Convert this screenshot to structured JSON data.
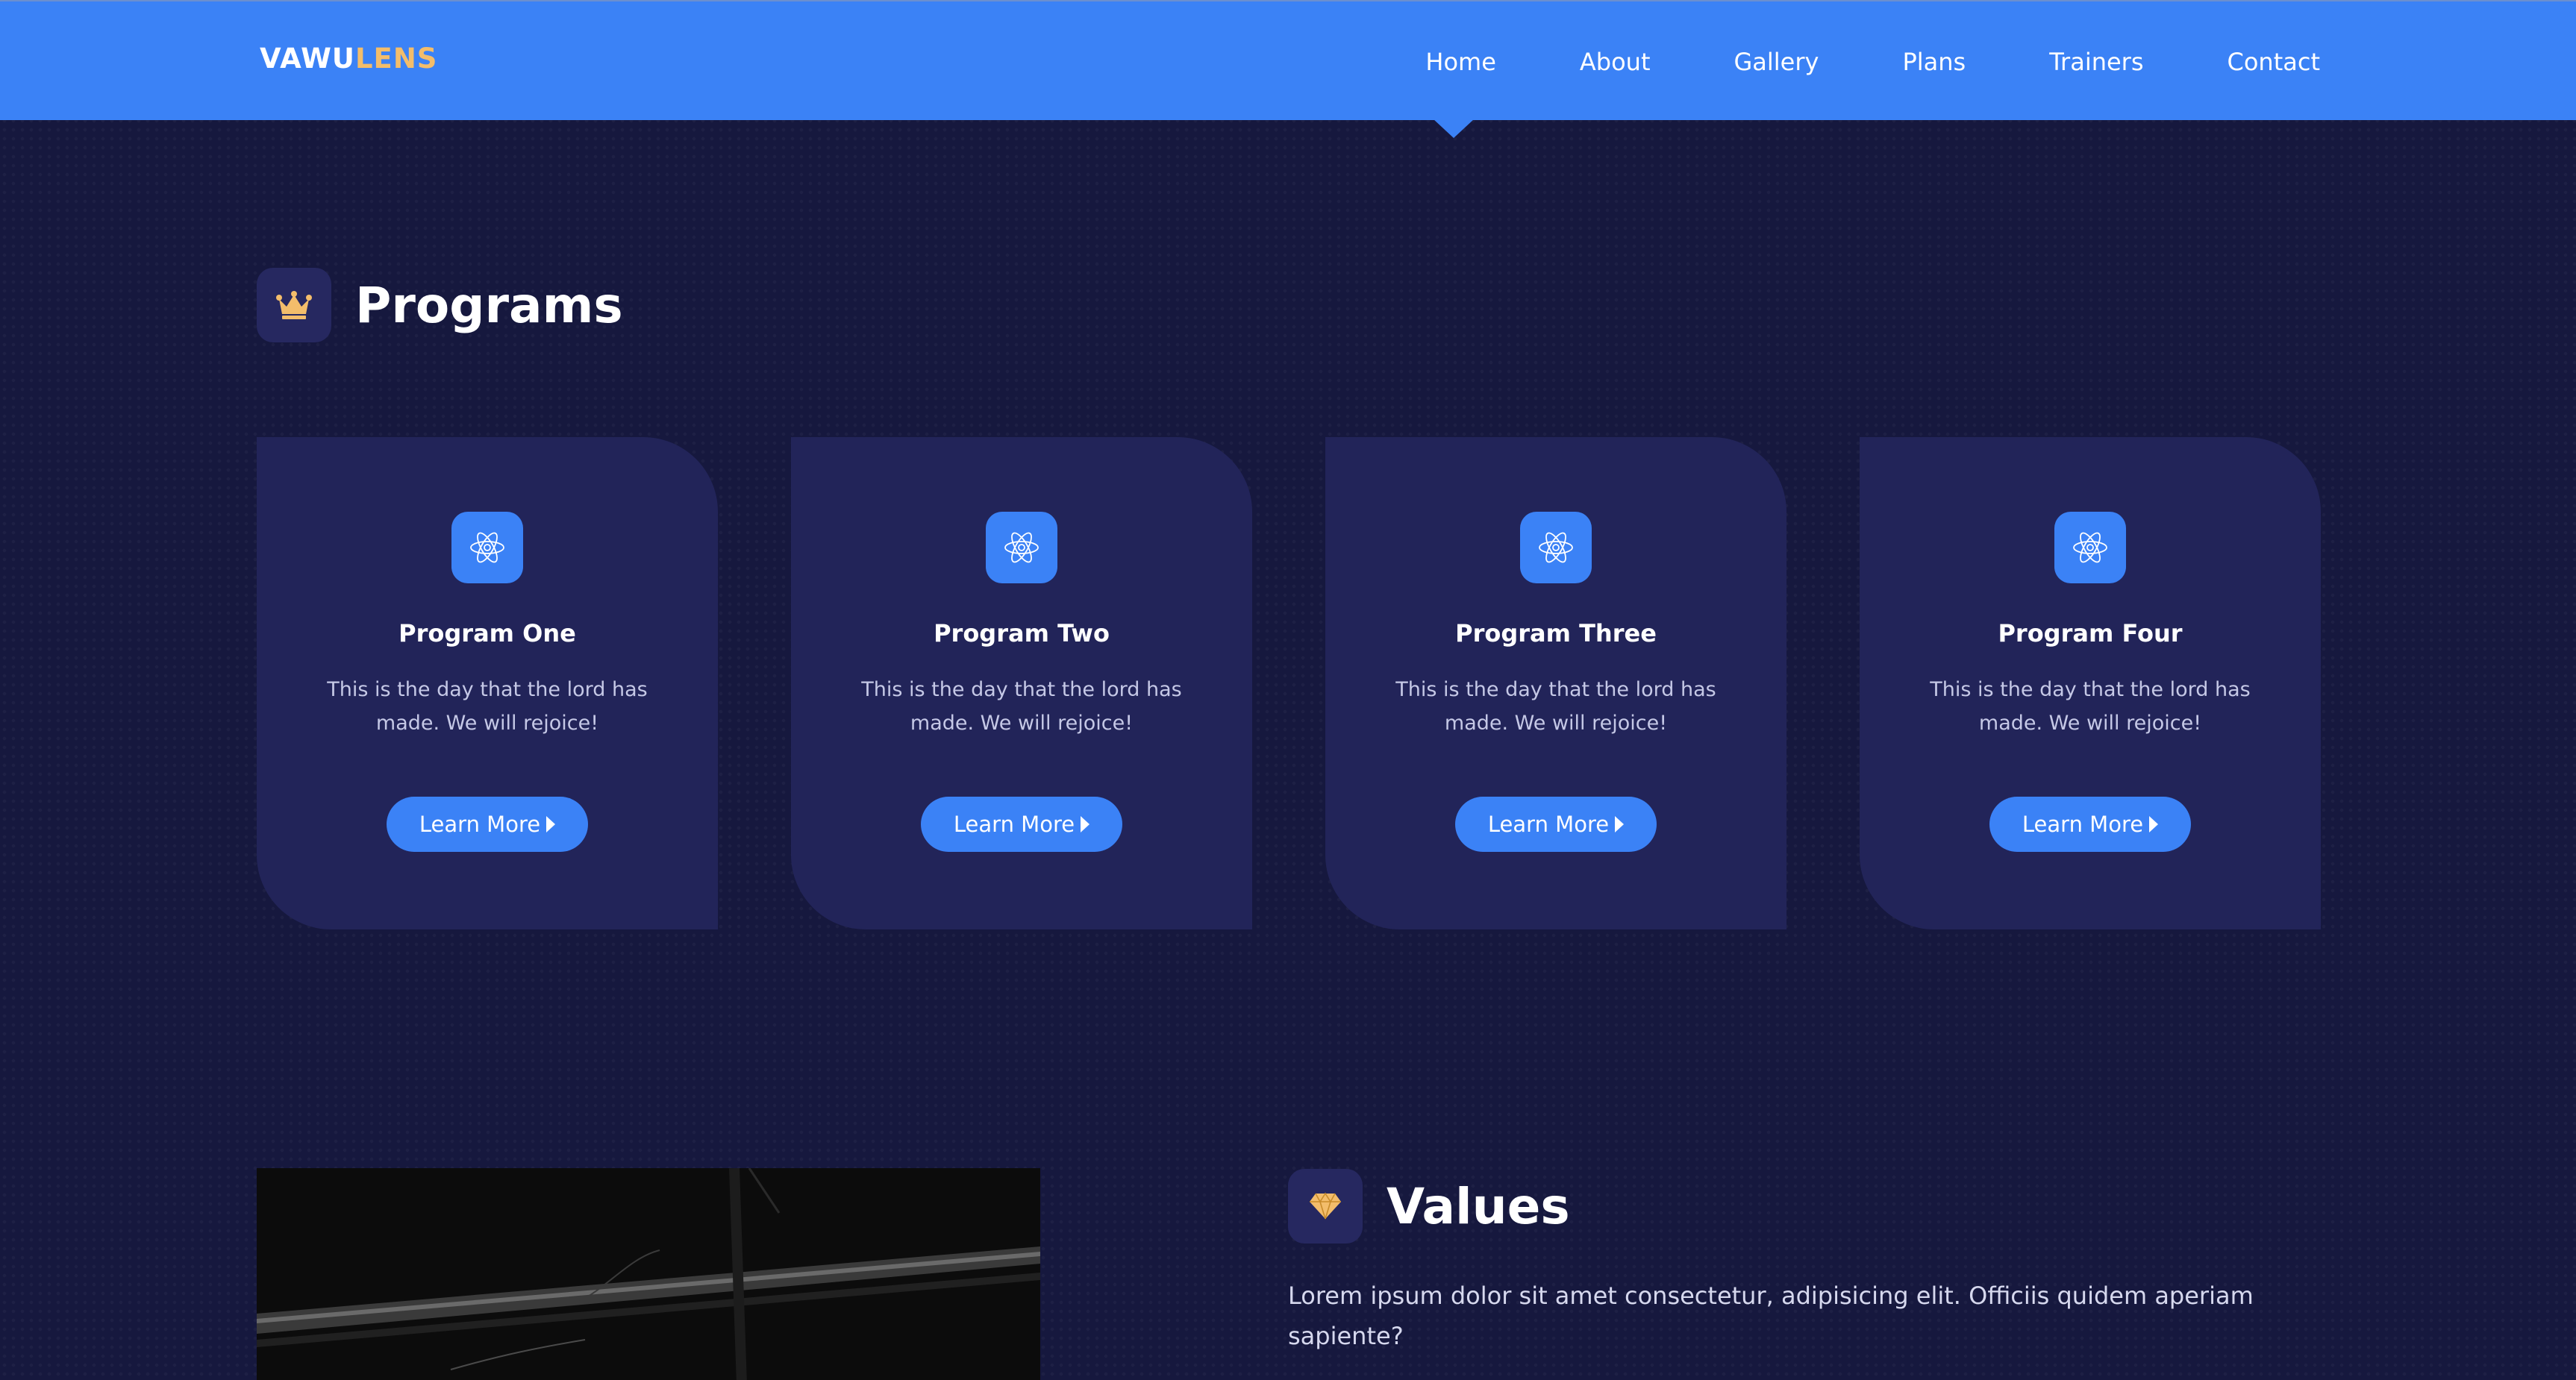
{
  "nav": {
    "logo_primary": "VAWU",
    "logo_accent": "LENS",
    "links": [
      "Home",
      "About",
      "Gallery",
      "Plans",
      "Trainers",
      "Contact"
    ],
    "active": "Home"
  },
  "programs": {
    "title": "Programs",
    "icon": "crown-icon",
    "cards": [
      {
        "title": "Program One",
        "text": "This is the day that the lord has made. We will rejoice!",
        "button": "Learn More",
        "icon": "atom-icon"
      },
      {
        "title": "Program Two",
        "text": "This is the day that the lord has made. We will rejoice!",
        "button": "Learn More",
        "icon": "atom-icon"
      },
      {
        "title": "Program Three",
        "text": "This is the day that the lord has made. We will rejoice!",
        "button": "Learn More",
        "icon": "atom-icon"
      },
      {
        "title": "Program Four",
        "text": "This is the day that the lord has made. We will rejoice!",
        "button": "Learn More",
        "icon": "atom-icon"
      }
    ]
  },
  "values": {
    "title": "Values",
    "icon": "gem-icon",
    "text": "Lorem ipsum dolor sit amet consectetur, adipisicing elit. Officiis quidem aperiam sapiente?"
  },
  "colors": {
    "primary": "#3b82f6",
    "accent": "#f3bd6b",
    "background": "#16183e",
    "card": "#222459"
  }
}
